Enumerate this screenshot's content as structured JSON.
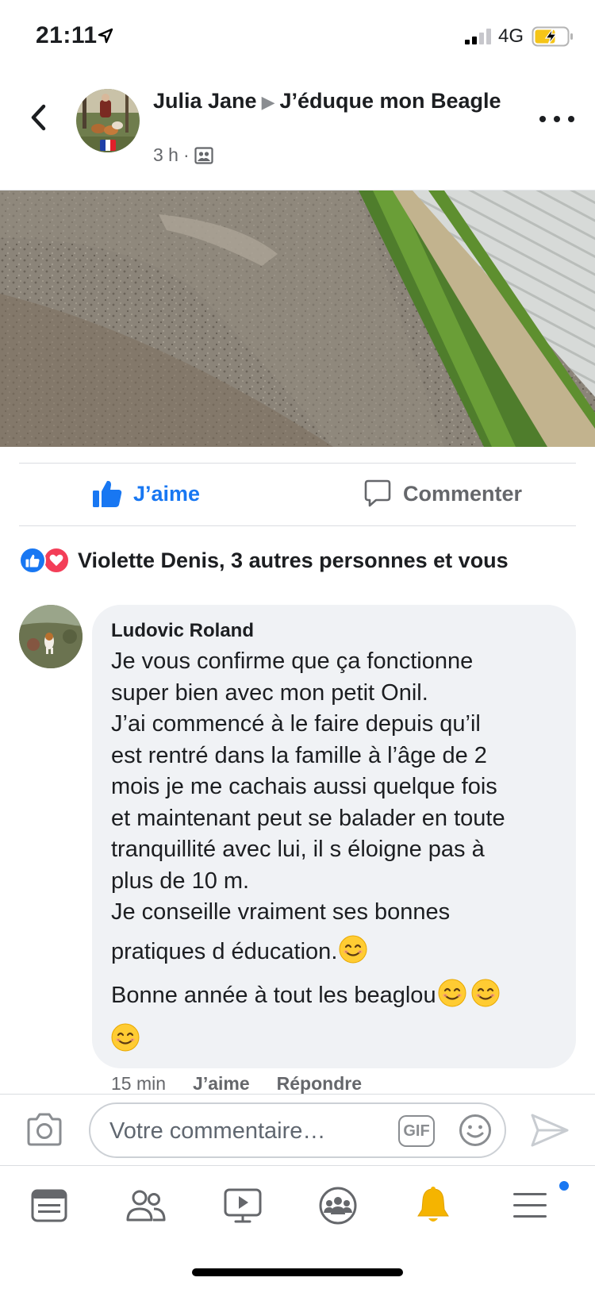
{
  "status_bar": {
    "time": "21:11",
    "network": "4G",
    "icons": [
      "location-arrow-icon",
      "signal-icon",
      "battery-charging-icon"
    ]
  },
  "header": {
    "author": "Julia Jane",
    "group": "J’éduque mon Beagle",
    "time": "3 h",
    "separator": "·",
    "audience_icon": "group-audience-icon",
    "icons": [
      "back-chevron-icon",
      "more-dots-icon"
    ]
  },
  "actions": {
    "like_label": "J’aime",
    "comment_label": "Commenter"
  },
  "reactions": {
    "text": "Violette Denis, 3 autres personnes et vous",
    "icons": [
      "like-reaction-icon",
      "love-reaction-icon"
    ]
  },
  "comment": {
    "author": "Ludovic Roland",
    "lines": [
      "Je vous confirme que ça fonctionne",
      "super bien avec mon petit Onil.",
      "J’ai commencé à  le faire depuis qu’il",
      "est rentré dans la famille à l’âge de 2",
      "mois  je me cachais aussi quelque fois",
      "et maintenant peut se balader en toute",
      "tranquillité avec lui, il s éloigne pas à",
      "plus de 10 m.",
      "Je conseille vraiment ses bonnes",
      "pratiques d éducation."
    ],
    "closing": "Bonne année à tout les beaglou",
    "emoji_icon": "smiling-face-emoji-icon",
    "time": "15 min",
    "like_label": "J’aime",
    "reply_label": "Répondre"
  },
  "composer": {
    "placeholder": "Votre commentaire…",
    "gif_label": "GIF",
    "icons": [
      "camera-icon",
      "emoji-face-icon",
      "send-icon"
    ]
  },
  "tabbar": {
    "tabs": [
      "news-feed-icon",
      "friends-icon",
      "watch-video-icon",
      "groups-icon",
      "notifications-bell-icon",
      "menu-icon"
    ],
    "colors": {
      "bell": "#f5b400",
      "dot": "#1877f2"
    }
  },
  "colors": {
    "accent": "#1877f2",
    "love": "#f33e58",
    "bubble": "#f0f2f5",
    "secondary_text": "#65676b"
  }
}
